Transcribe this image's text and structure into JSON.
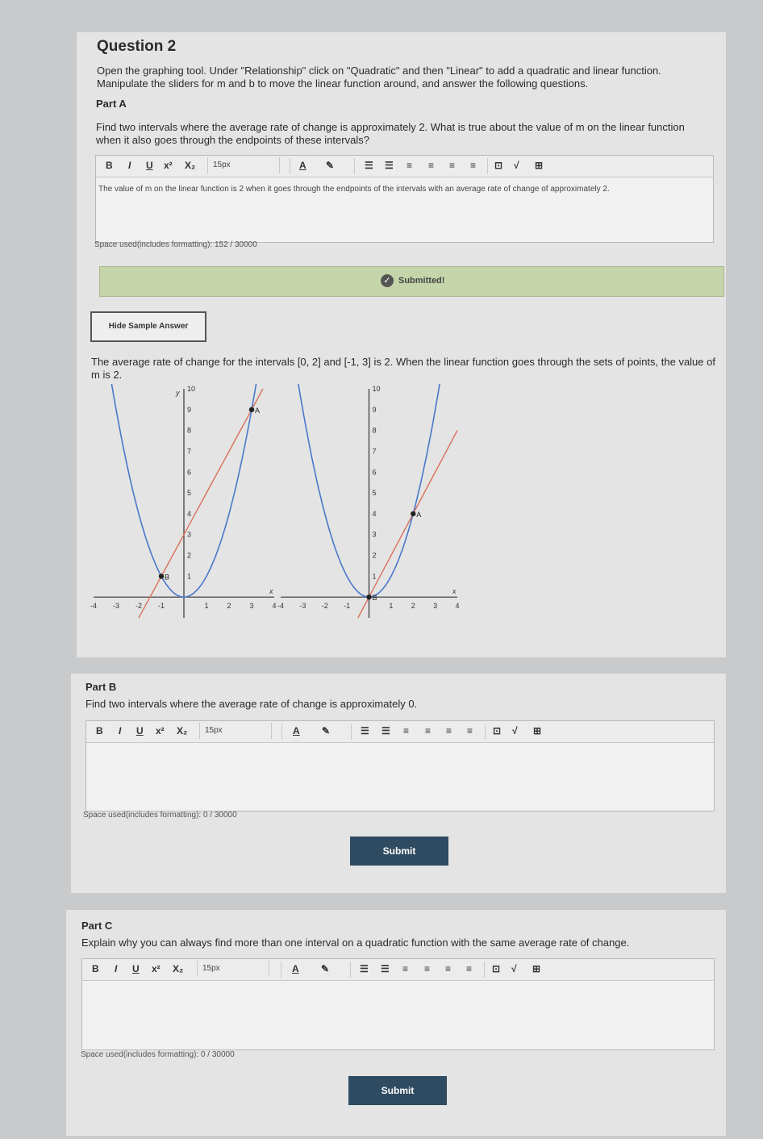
{
  "question_title": "Question 2",
  "question_prompt": "Open the graphing tool. Under \"Relationship\" click on \"Quadratic\" and then \"Linear\" to add a quadratic and linear function. Manipulate the sliders for m and b to move the linear function around, and answer the following questions.",
  "toolbar": {
    "bold": "B",
    "italic": "I",
    "underline": "U",
    "superscript": "x²",
    "subscript": "X₂",
    "font_size": "15px",
    "font_color": "A",
    "highlight": "✎",
    "image": "⊡",
    "formula": "√",
    "table": "⊞"
  },
  "part_a": {
    "heading": "Part A",
    "prompt": "Find two intervals where the average rate of change is approximately 2. What is true about the value of m on the linear function when it also goes through the endpoints of these intervals?",
    "answer": "The value of m on the linear function is 2 when it goes through the endpoints of the intervals with an average rate of change of approximately 2.",
    "counter": "Space used(includes formatting): 152 / 30000",
    "status": "Submitted!",
    "hide_button": "Hide Sample Answer",
    "sample_answer": "The average rate of change for the intervals [0, 2] and [-1, 3] is 2. When the linear function goes through the sets of points, the value of m is 2."
  },
  "chart_data": [
    {
      "type": "line",
      "xlim": [
        -4,
        4
      ],
      "ylim": [
        -1,
        10
      ],
      "x_ticks": [
        "-4",
        "-3",
        "-2",
        "-1",
        "1",
        "2",
        "3",
        "4"
      ],
      "y_ticks": [
        "1",
        "2",
        "3",
        "4",
        "5",
        "6",
        "7",
        "8",
        "9",
        "10"
      ],
      "xlabel": "x",
      "ylabel": "y",
      "series": [
        {
          "kind": "parabola",
          "a": 1,
          "h": 0,
          "k": 0,
          "color": "#4a78c8"
        },
        {
          "kind": "line",
          "m": 2,
          "b": 3,
          "color": "#d9715a"
        }
      ],
      "points": [
        {
          "label": "A",
          "x": 3,
          "y": 9
        },
        {
          "label": "B",
          "x": -1,
          "y": 1
        }
      ]
    },
    {
      "type": "line",
      "xlim": [
        -4,
        4
      ],
      "ylim": [
        -1,
        10
      ],
      "x_ticks": [
        "-4",
        "-3",
        "-2",
        "-1",
        "1",
        "2",
        "3",
        "4"
      ],
      "y_ticks": [
        "1",
        "2",
        "3",
        "4",
        "5",
        "6",
        "7",
        "8",
        "9",
        "10"
      ],
      "xlabel": "x",
      "ylabel": "",
      "series": [
        {
          "kind": "parabola",
          "a": 1,
          "h": 0,
          "k": 0,
          "color": "#4a78c8"
        },
        {
          "kind": "line",
          "m": 2,
          "b": 0,
          "color": "#d9715a"
        }
      ],
      "points": [
        {
          "label": "A",
          "x": 2,
          "y": 4
        },
        {
          "label": "B",
          "x": 0,
          "y": 0
        }
      ]
    }
  ],
  "part_b": {
    "heading": "Part B",
    "prompt": "Find two intervals where the average rate of change is approximately 0.",
    "counter": "Space used(includes formatting): 0 / 30000",
    "submit": "Submit"
  },
  "part_c": {
    "heading": "Part C",
    "prompt": "Explain why you can always find more than one interval on a quadratic function with the same average rate of change.",
    "counter": "Space used(includes formatting): 0 / 30000",
    "submit": "Submit"
  }
}
